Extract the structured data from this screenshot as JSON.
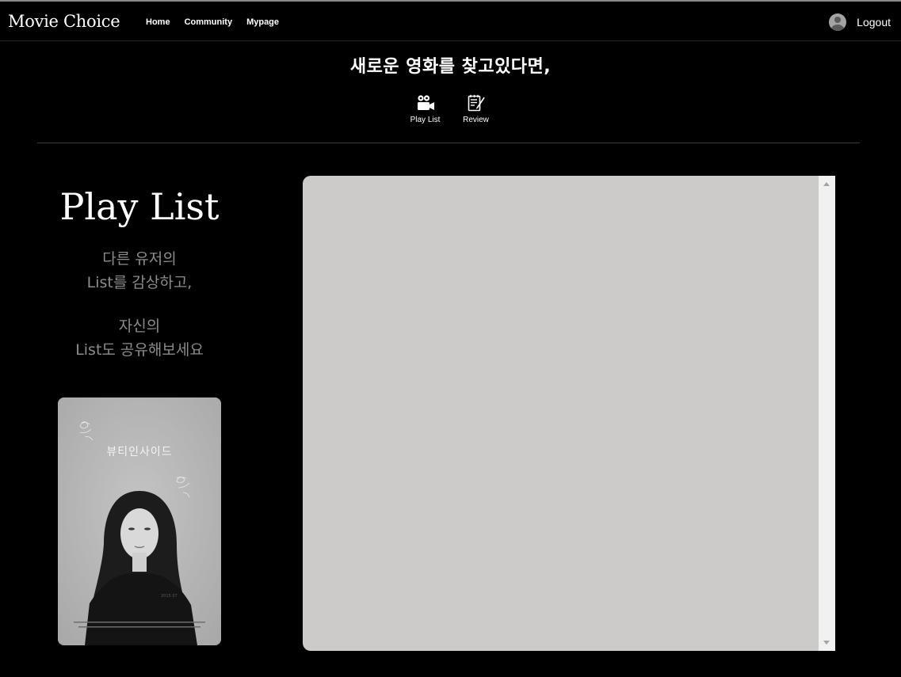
{
  "header": {
    "brand": "Movie Choice",
    "nav": [
      "Home",
      "Community",
      "Mypage"
    ],
    "logout_label": "Logout"
  },
  "hero": {
    "title": "새로운 영화를 찾고있다면,",
    "menu": [
      {
        "label": "Play List",
        "icon": "movie-camera-icon"
      },
      {
        "label": "Review",
        "icon": "review-notepad-icon"
      }
    ]
  },
  "section": {
    "title": "Play List",
    "desc_a_line1": "다른 유저의",
    "desc_a_line2": "List를 감상하고,",
    "desc_b_line1": "자신의",
    "desc_b_line2": "List도 공유해보세요"
  },
  "poster": {
    "title": "뷰티인사이드",
    "date": "2015.07"
  },
  "colors": {
    "background": "#000000",
    "panel": "#cccbc9",
    "muted_text": "#8c8c8c"
  }
}
